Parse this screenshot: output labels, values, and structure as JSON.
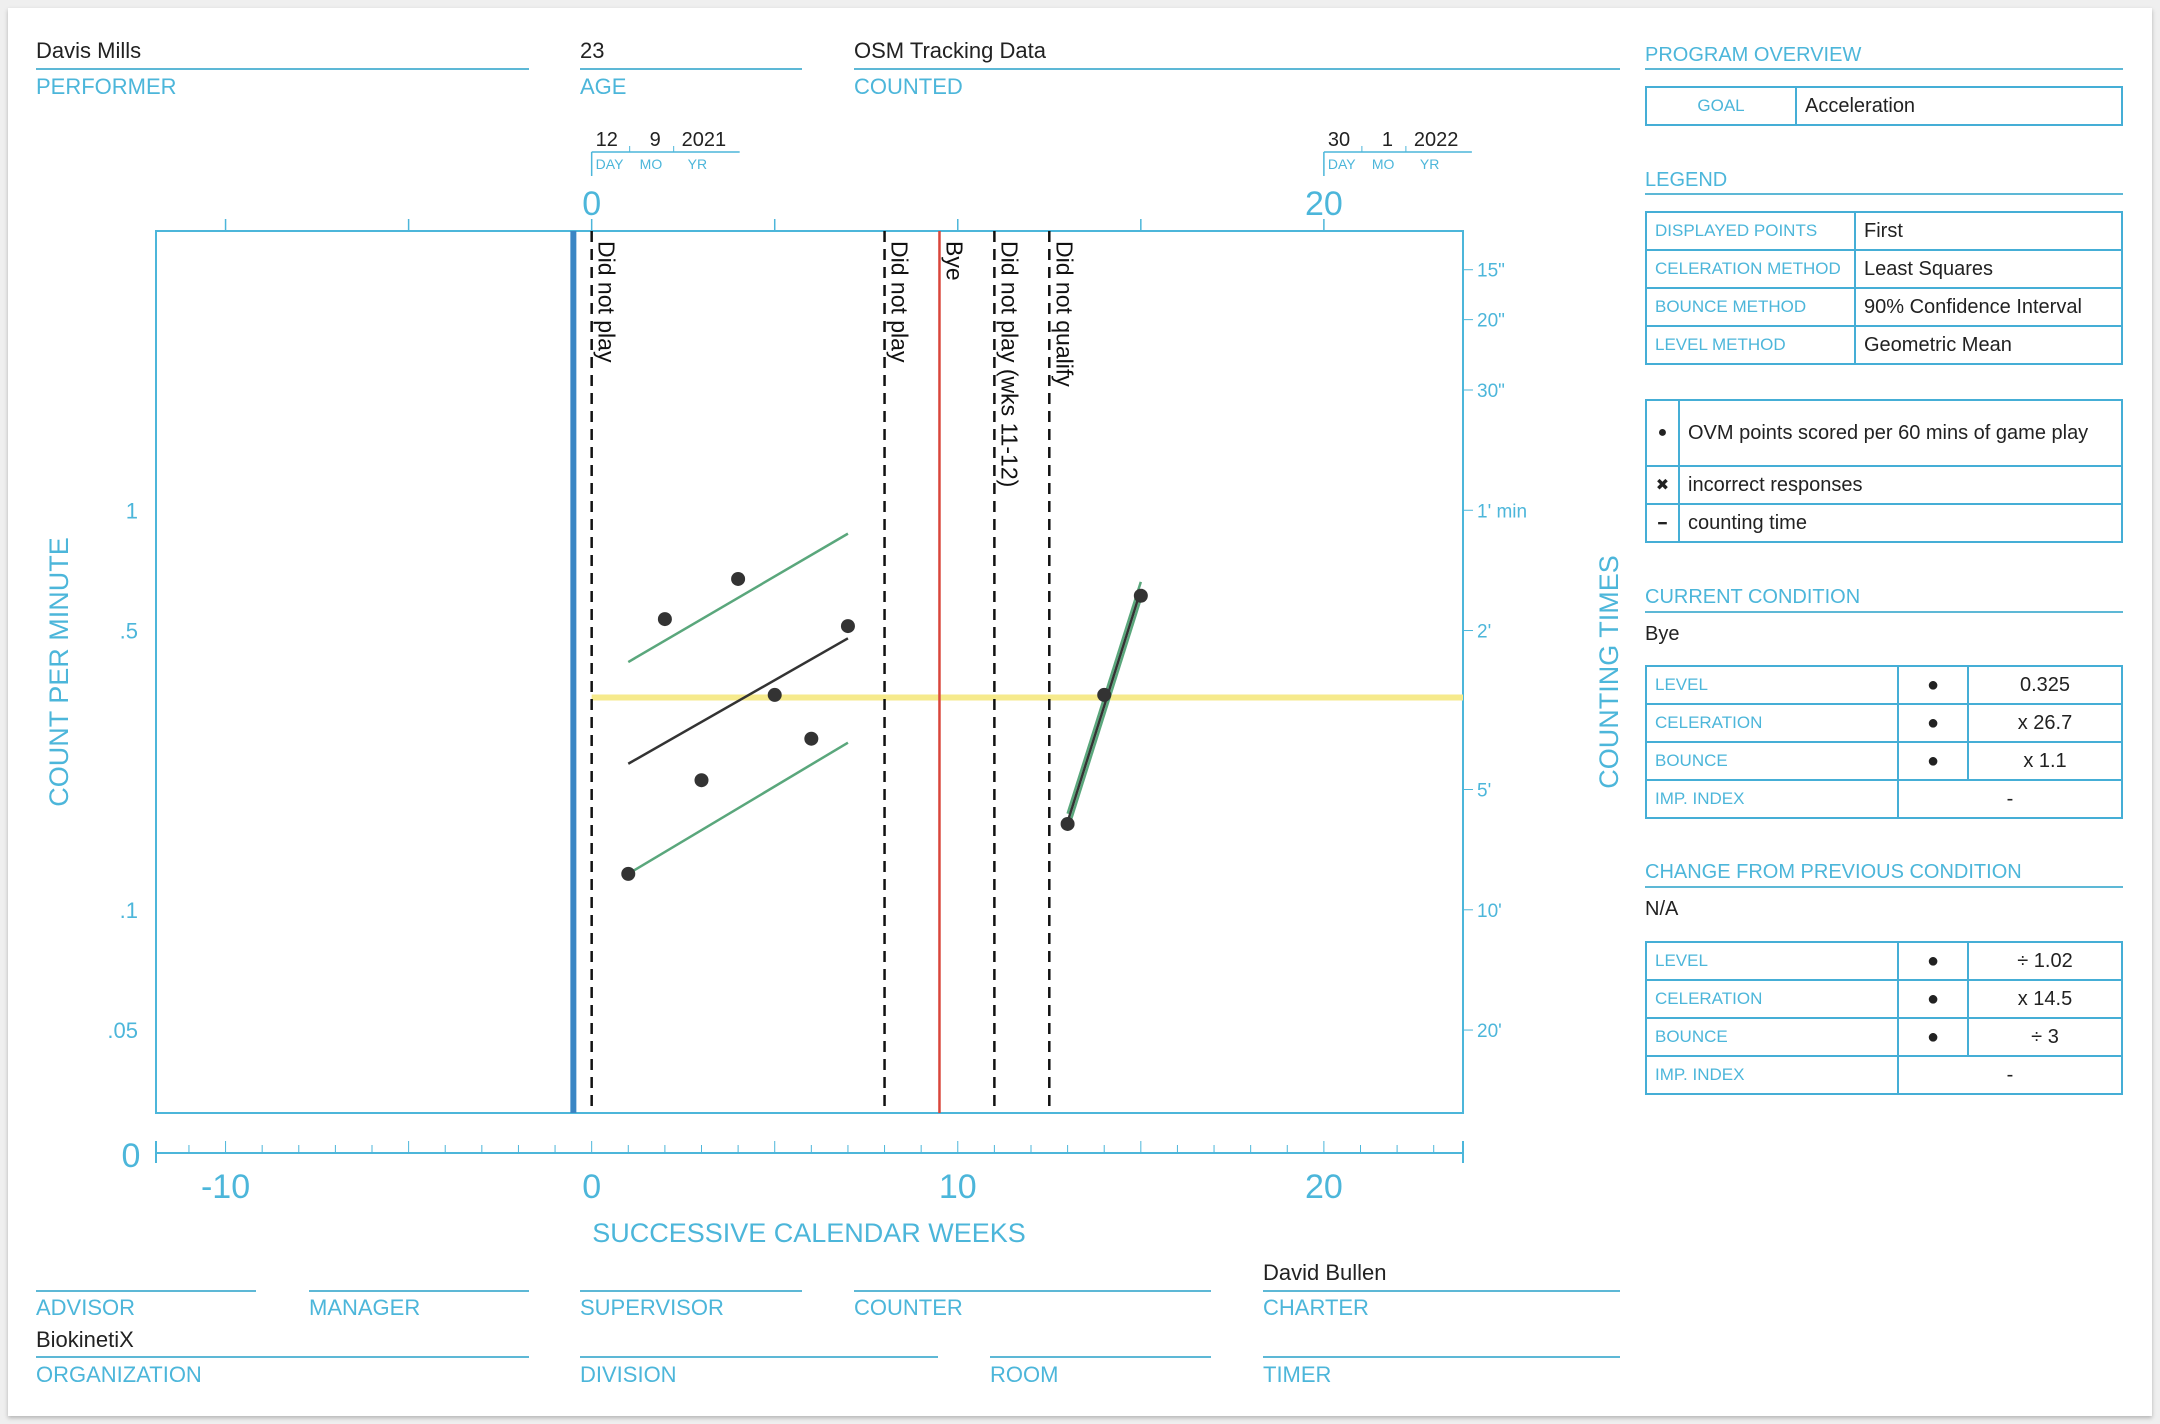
{
  "header": {
    "performer": {
      "value": "Davis Mills",
      "label": "PERFORMER"
    },
    "age": {
      "value": "23",
      "label": "AGE"
    },
    "counted": {
      "value": "OSM Tracking Data",
      "label": "COUNTED"
    }
  },
  "footer": {
    "advisor": {
      "value": "",
      "label": "ADVISOR"
    },
    "manager": {
      "value": "",
      "label": "MANAGER"
    },
    "supervisor": {
      "value": "",
      "label": "SUPERVISOR"
    },
    "counter": {
      "value": "",
      "label": "COUNTER"
    },
    "charter": {
      "value": "David Bullen",
      "label": "CHARTER"
    },
    "organization": {
      "value": "BiokinetiX",
      "label": "ORGANIZATION"
    },
    "division": {
      "value": "",
      "label": "DIVISION"
    },
    "room": {
      "value": "",
      "label": "ROOM"
    },
    "timer": {
      "value": "",
      "label": "TIMER"
    }
  },
  "panel": {
    "program_overview": {
      "title": "PROGRAM OVERVIEW",
      "goal_label": "GOAL",
      "goal": "Acceleration"
    },
    "legend": {
      "title": "LEGEND",
      "rows": [
        {
          "k": "DISPLAYED POINTS",
          "v": "First"
        },
        {
          "k": "CELERATION METHOD",
          "v": "Least Squares"
        },
        {
          "k": "BOUNCE METHOD",
          "v": "90% Confidence Interval"
        },
        {
          "k": "LEVEL METHOD",
          "v": "Geometric Mean"
        }
      ],
      "symbols": [
        {
          "icon": "filled-dot",
          "symbol": "●",
          "text": "OVM points scored per 60 mins of game play"
        },
        {
          "icon": "x-mark",
          "symbol": "✖",
          "text": "incorrect responses"
        },
        {
          "icon": "dash",
          "symbol": "━",
          "text": "counting time"
        }
      ]
    },
    "current_condition": {
      "title": "CURRENT CONDITION",
      "name": "Bye",
      "rows": [
        {
          "k": "LEVEL",
          "sym": "●",
          "v": "0.325"
        },
        {
          "k": "CELERATION",
          "sym": "●",
          "v": "x 26.7"
        },
        {
          "k": "BOUNCE",
          "sym": "●",
          "v": "x 1.1"
        },
        {
          "k": "IMP. INDEX",
          "v": "-"
        }
      ]
    },
    "change_from_previous": {
      "title": "CHANGE FROM PREVIOUS CONDITION",
      "name": "N/A",
      "rows": [
        {
          "k": "LEVEL",
          "sym": "●",
          "v": "÷ 1.02"
        },
        {
          "k": "CELERATION",
          "sym": "●",
          "v": "x 14.5"
        },
        {
          "k": "BOUNCE",
          "sym": "●",
          "v": "÷ 3"
        },
        {
          "k": "IMP. INDEX",
          "v": "-"
        }
      ]
    }
  },
  "colors": {
    "accent": "#4cb6da",
    "phase_line": "#3a86c4",
    "bye_line": "#d9463b",
    "bounce": "#5aa77c",
    "level": "#f6ea8c",
    "points": "#333333"
  },
  "chart_data": {
    "type": "scatter",
    "yscale": "log",
    "xlabel": "SUCCESSIVE CALENDAR WEEKS",
    "ylabel": "COUNT PER MINUTE",
    "y2label": "COUNTING TIMES",
    "xlim": [
      -11.9,
      23.8
    ],
    "ylim": [
      0.031,
      5
    ],
    "grid": false,
    "x_origin_label": "0",
    "x_ticks_bottom": [
      {
        "v": -10,
        "label": "-10"
      },
      {
        "v": 0,
        "label": "0"
      },
      {
        "v": 10,
        "label": "10"
      },
      {
        "v": 20,
        "label": "20"
      }
    ],
    "x_ticks_top": [
      {
        "v": 0,
        "label": "0"
      },
      {
        "v": 20,
        "label": "20"
      }
    ],
    "top_dates": [
      {
        "week": 0,
        "day": "12",
        "mo": "9",
        "yr": "2021"
      },
      {
        "week": 20,
        "day": "30",
        "mo": "1",
        "yr": "2022"
      }
    ],
    "date_labels": {
      "day": "DAY",
      "mo": "MO",
      "yr": "YR"
    },
    "y_ticks_left": [
      {
        "v": 1,
        "label": "1"
      },
      {
        "v": 0.5,
        "label": ".5"
      },
      {
        "v": 0.1,
        "label": ".1"
      },
      {
        "v": 0.05,
        "label": ".05"
      }
    ],
    "y_ticks_right": [
      {
        "v": 4,
        "label": "15\""
      },
      {
        "v": 3,
        "label": "20\""
      },
      {
        "v": 2,
        "label": "30\""
      },
      {
        "v": 1,
        "label": "1' min"
      },
      {
        "v": 0.5,
        "label": "2'"
      },
      {
        "v": 0.2,
        "label": "5'"
      },
      {
        "v": 0.1,
        "label": "10'"
      },
      {
        "v": 0.05,
        "label": "20'"
      }
    ],
    "points": [
      {
        "x": 1,
        "y": 0.123
      },
      {
        "x": 2,
        "y": 0.534
      },
      {
        "x": 3,
        "y": 0.211
      },
      {
        "x": 4,
        "y": 0.673
      },
      {
        "x": 5,
        "y": 0.345
      },
      {
        "x": 6,
        "y": 0.268
      },
      {
        "x": 7,
        "y": 0.513
      },
      {
        "x": 13,
        "y": 0.164
      },
      {
        "x": 14,
        "y": 0.345
      },
      {
        "x": 15,
        "y": 0.611
      }
    ],
    "phase_change_week": -0.5,
    "condition_lines": [
      {
        "week": 0,
        "label": "Did not play",
        "style": "dashed"
      },
      {
        "week": 8,
        "label": "Did not play",
        "style": "dashed"
      },
      {
        "week": 9.5,
        "label": "Bye",
        "style": "red"
      },
      {
        "week": 11,
        "label": "Did not play (wks 11-12)",
        "style": "dashed"
      },
      {
        "week": 12.5,
        "label": "Did not qualify",
        "style": "dashed"
      }
    ],
    "celeration_lines": [
      {
        "x": [
          1,
          7
        ],
        "y": [
          0.232,
          0.478
        ],
        "color": "#333333"
      },
      {
        "x": [
          13,
          15
        ],
        "y": [
          0.166,
          0.631
        ],
        "color": "#333333"
      }
    ],
    "bounce_lines": [
      {
        "x": [
          1,
          7
        ],
        "y": [
          0.417,
          0.874
        ]
      },
      {
        "x": [
          1,
          7
        ],
        "y": [
          0.123,
          0.262
        ]
      },
      {
        "x": [
          13,
          15
        ],
        "y": [
          0.174,
          0.662
        ]
      },
      {
        "x": [
          13,
          15
        ],
        "y": [
          0.158,
          0.601
        ]
      }
    ],
    "level_line": {
      "x": [
        0,
        23.8
      ],
      "y": 0.34
    }
  }
}
